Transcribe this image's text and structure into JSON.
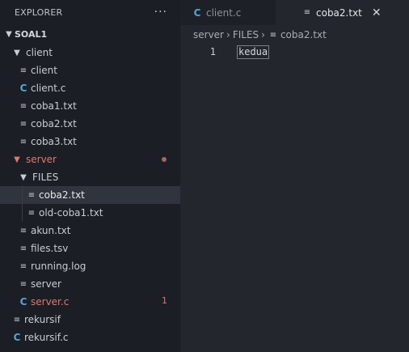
{
  "sidebar": {
    "title": "EXPLORER",
    "more": "···",
    "section": "SOAL1",
    "rows": [
      {
        "label": "client",
        "kind": "folder",
        "open": true
      },
      {
        "label": "client",
        "kind": "file"
      },
      {
        "label": "client.c",
        "kind": "c"
      },
      {
        "label": "coba1.txt",
        "kind": "file"
      },
      {
        "label": "coba2.txt",
        "kind": "file"
      },
      {
        "label": "coba3.txt",
        "kind": "file"
      },
      {
        "label": "server",
        "kind": "folder",
        "open": true,
        "modified": true
      },
      {
        "label": "FILES",
        "kind": "folder",
        "open": true
      },
      {
        "label": "coba2.txt",
        "kind": "file",
        "selected": true
      },
      {
        "label": "old-coba1.txt",
        "kind": "file"
      },
      {
        "label": "akun.txt",
        "kind": "file"
      },
      {
        "label": "files.tsv",
        "kind": "file"
      },
      {
        "label": "running.log",
        "kind": "file"
      },
      {
        "label": "server",
        "kind": "file"
      },
      {
        "label": "server.c",
        "kind": "c",
        "problems": "1"
      },
      {
        "label": "rekursif",
        "kind": "file"
      },
      {
        "label": "rekursif.c",
        "kind": "c"
      }
    ]
  },
  "tabs": [
    {
      "label": "client.c",
      "icon": "c-file-icon"
    },
    {
      "label": "coba2.txt",
      "icon": "text-file-icon",
      "active": true,
      "close": "✕"
    }
  ],
  "breadcrumb": {
    "items": [
      "server",
      "FILES",
      "coba2.txt"
    ],
    "sep": "›"
  },
  "editor": {
    "lines": [
      {
        "number": "1",
        "text": "kedua"
      }
    ]
  },
  "colors": {
    "c_icon": "#4fa6d8",
    "modified_red": "#e0776a",
    "selected_row": "#2f343d"
  }
}
